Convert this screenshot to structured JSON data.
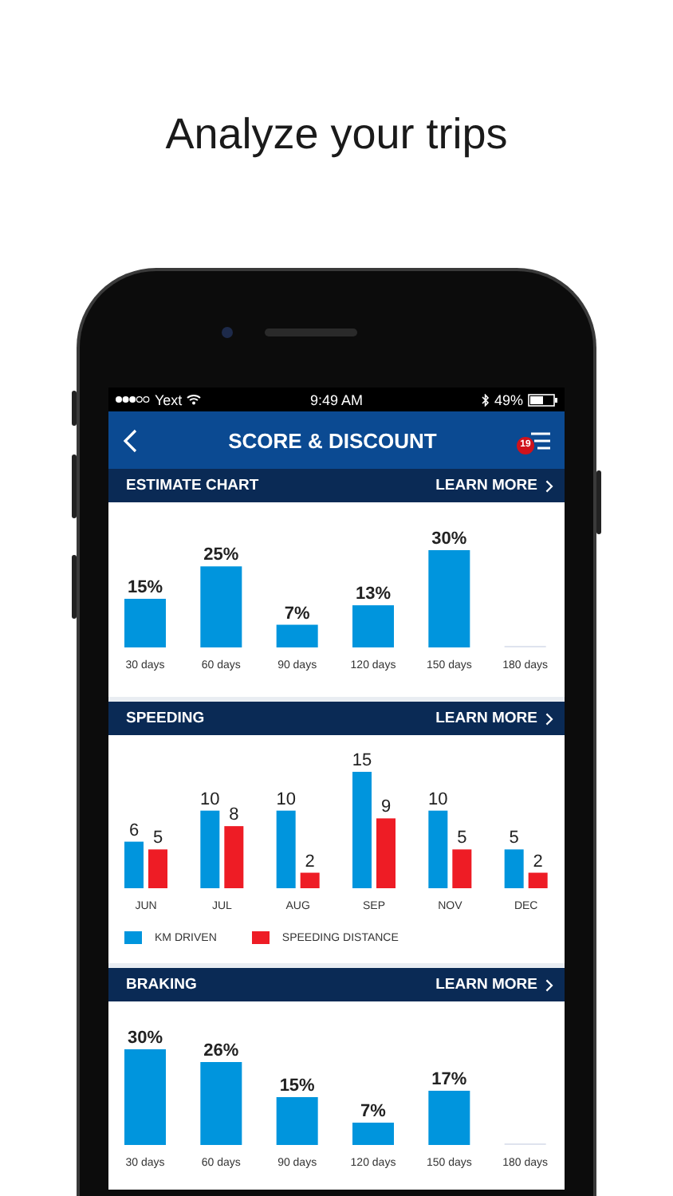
{
  "headline": "Analyze your trips",
  "status_bar": {
    "carrier": "Yext",
    "time": "9:49 AM",
    "battery": "49%"
  },
  "nav": {
    "title": "SCORE & DISCOUNT",
    "badge": "19"
  },
  "sections": [
    {
      "title": "ESTIMATE CHART",
      "link": "LEARN MORE",
      "chart_data": {
        "type": "bar",
        "categories": [
          "30 days",
          "60 days",
          "90 days",
          "120 days",
          "150 days",
          "180 days"
        ],
        "values": [
          15,
          25,
          7,
          13,
          30,
          null
        ],
        "data_labels": true,
        "value_labels": [
          "15%",
          "25%",
          "7%",
          "13%",
          "30%",
          null
        ]
      }
    },
    {
      "title": "SPEEDING",
      "link": "LEARN MORE",
      "chart_data": {
        "type": "bar",
        "categories": [
          "JUN",
          "JUL",
          "AUG",
          "SEP",
          "NOV",
          "DEC"
        ],
        "series": [
          {
            "name": "KM DRIVEN",
            "color": "#0095dd",
            "values": [
              6,
              10,
              10,
              15,
              10,
              5
            ]
          },
          {
            "name": "SPEEDING DISTANCE",
            "color": "#ee1c25",
            "values": [
              5,
              8,
              2,
              9,
              5,
              2
            ]
          }
        ],
        "data_labels": true
      }
    },
    {
      "title": "BRAKING",
      "link": "LEARN MORE",
      "chart_data": {
        "type": "bar",
        "categories": [
          "30 days",
          "60 days",
          "90 days",
          "120 days",
          "150 days",
          "180 days"
        ],
        "values": [
          30,
          26,
          15,
          7,
          17,
          null
        ],
        "data_labels": true,
        "value_labels": [
          "30%",
          "26%",
          "15%",
          "7%",
          "17%",
          null
        ]
      }
    }
  ]
}
